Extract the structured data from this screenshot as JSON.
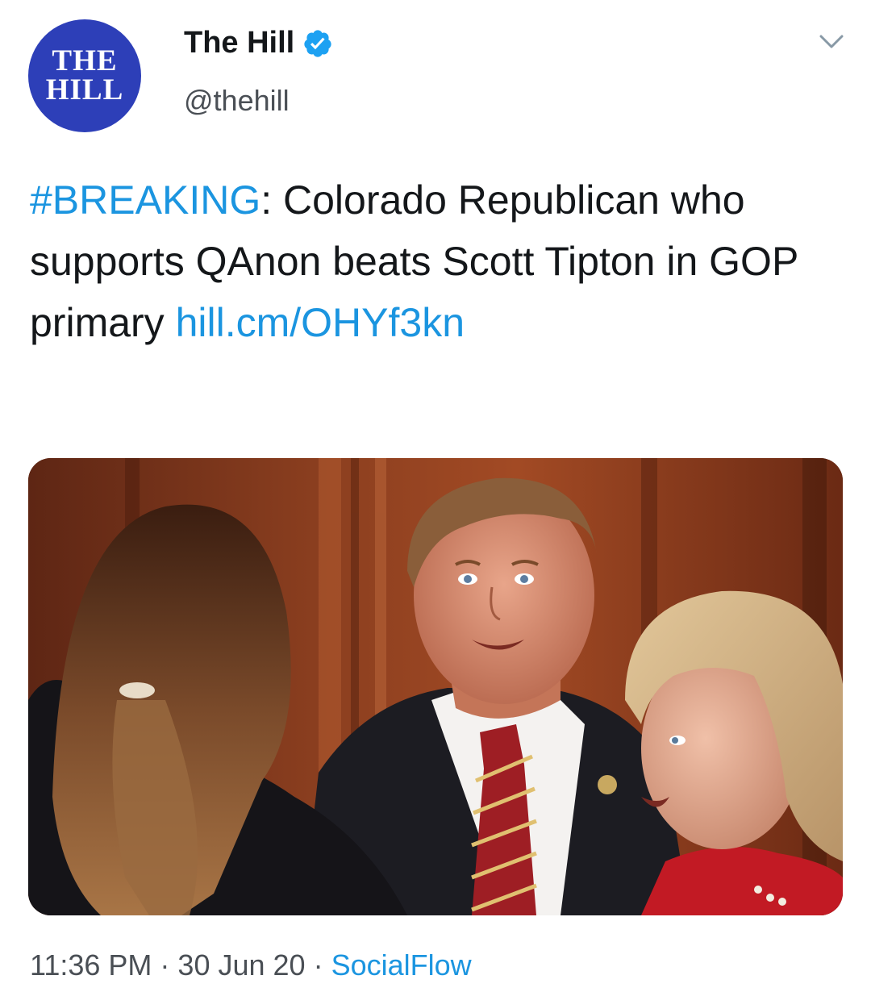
{
  "author": {
    "avatar_line1": "THE",
    "avatar_line2": "HILL",
    "name": "The Hill",
    "handle": "@thehill",
    "verified": true,
    "avatar_color": "#2d3fb8"
  },
  "tweet": {
    "hashtag": "#BREAKING",
    "text_after_hashtag": ": Colorado Republican who supports QAnon beats Scott Tipton in GOP primary ",
    "link_text": "hill.cm/OHYf3kn",
    "link_color": "#1b95e0"
  },
  "footer": {
    "time": "11:36 PM",
    "date": "30 Jun 20",
    "separator": " · ",
    "source": "SocialFlow"
  },
  "icons": {
    "verified": "verified-badge-icon",
    "menu": "chevron-down-icon"
  }
}
